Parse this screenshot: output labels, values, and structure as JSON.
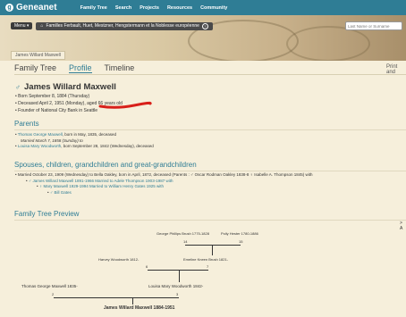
{
  "nav": {
    "logo_text": "Geneanet",
    "logo_mark": "g",
    "links": [
      "Family Tree",
      "Search",
      "Projects",
      "Resources",
      "Community"
    ]
  },
  "header": {
    "menu_label": "Menu ▾",
    "family_text": "Familles Ferbault, Huet, Mestzner, Hengstermann et la Noblesse européenne",
    "search_placeholder": "Last Name or Surname"
  },
  "person_tab": "James Willard Maxwell",
  "tabs": [
    {
      "label": "Family Tree"
    },
    {
      "label": "Profile"
    },
    {
      "label": "Timeline"
    }
  ],
  "print_label": "Print and",
  "person": {
    "name": "James Willard Maxwell",
    "facts": [
      "Born September 8, 1884 (Thursday)",
      "Deceased April 2, 1951 (Monday), aged 66 years old",
      "Founder of National City Bank in Seattle"
    ]
  },
  "parents": {
    "title": "Parents",
    "father_name": "Thomas George Maxwell",
    "father_born": ", born in May, 1835, deceased",
    "married": "Married March 7, 1858 (Sunday) to",
    "mother_name": "Louisa Mary Woodworth",
    "mother_born": ", born September 28, 1842 (Wednesday), deceased"
  },
  "spouses": {
    "title": "Spouses, children, grandchildren and great-grandchildren",
    "line1": "Married October 23, 1909 (Wednesday) to Bella Oakley, born in April, 1872, deceased (Parents : ♂ Oscar Rodman Oakley 1838-8  ♀ Isabelle A. Thompson 1845) with",
    "line2": "♂ James Willard Maxwell 1891-1966  Married to Adele Thompson 1903-1987 with",
    "line3": "♀ Mary Maxwell 1929-1994  Married to William Henry Gates 1925 with",
    "line4": "♂ Bill Gates"
  },
  "tree": {
    "title": "Family Tree Preview",
    "g1a": "George Phillips Brush 1775-1828",
    "g1a_num": "14",
    "g1b": "Polly Hester 1780-1886",
    "g1b_num": "15",
    "g2a": "Harvey Woodworth 1812-",
    "g2a_num": "6",
    "g2b": "Emeline Kneen Brush 1821-",
    "g2b_num": "7",
    "g3a": "Thomas George Maxwell 1835-",
    "g3a_num": "2",
    "g3b": "Louisa Mary Woodworth 1842-",
    "g3b_num": "3",
    "root": "James Willard Maxwell 1884-1951",
    "arrow": "> A"
  },
  "colors": {
    "accent": "#2f7d95",
    "background": "#f6efdb",
    "annotation": "#d8201a"
  }
}
